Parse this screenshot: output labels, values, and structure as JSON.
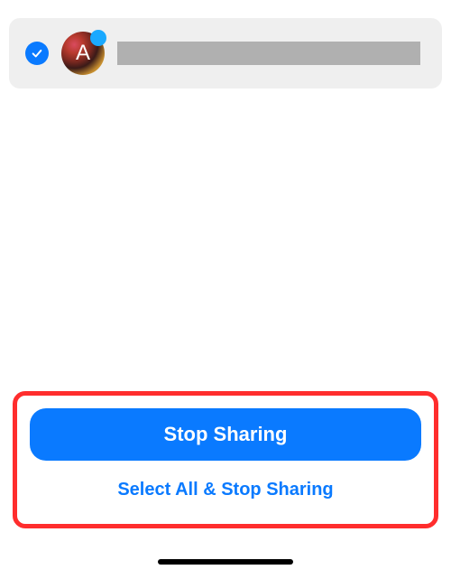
{
  "contact": {
    "checked": true,
    "avatar_letter": "A"
  },
  "actions": {
    "stop_sharing_label": "Stop Sharing",
    "select_all_label": "Select All & Stop Sharing"
  },
  "colors": {
    "accent": "#0a7aff",
    "highlight_border": "#ff2d2d"
  }
}
